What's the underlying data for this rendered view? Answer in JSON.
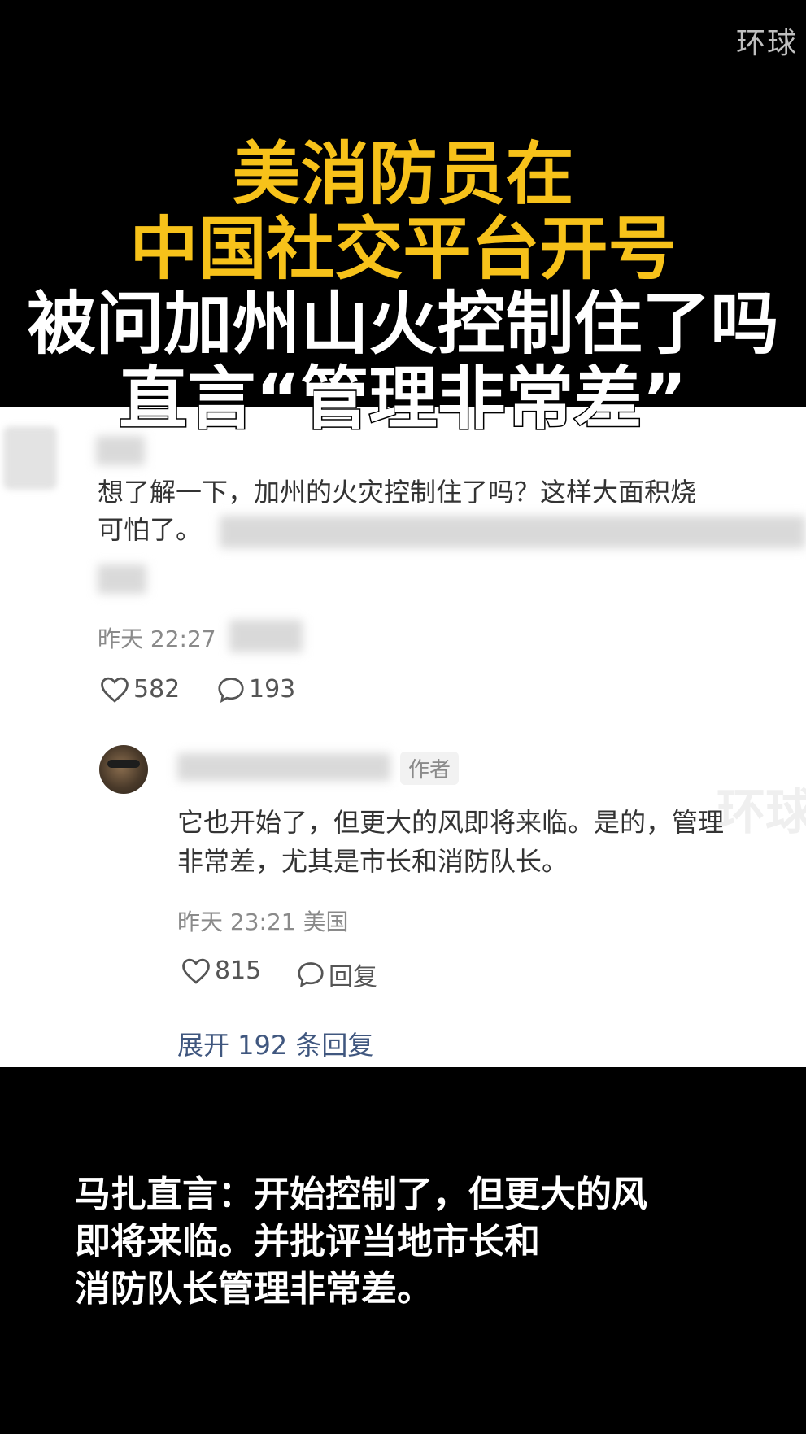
{
  "watermark": "环球",
  "headline": {
    "line1": "美消防员在",
    "line2": "中国社交平台开号",
    "line3": "被问加州山火控制住了吗",
    "line4": "直言“管理非常差”",
    "color_yellow": "#f7c21a",
    "color_white": "#ffffff"
  },
  "comment": {
    "text_line1": "想了解一下，加州的火灾控制住了吗？这样大面积烧",
    "text_line2": "可怕了。",
    "time": "昨天 22:27",
    "like_count": "582",
    "comment_count": "193"
  },
  "reply": {
    "author_tag": "作者",
    "text_line1": "它也开始了，但更大的风即将来临。是的，管理",
    "text_line2": "非常差，尤其是市长和消防队长。",
    "time_location": "昨天 23:21 美国",
    "like_count": "815",
    "reply_label": "回复"
  },
  "expand_replies": "展开 192 条回复",
  "caption": {
    "line1": "马扎直言：开始控制了，但更大的风",
    "line2": "即将来临。并批评当地市长和",
    "line3": "消防队长管理非常差。"
  }
}
